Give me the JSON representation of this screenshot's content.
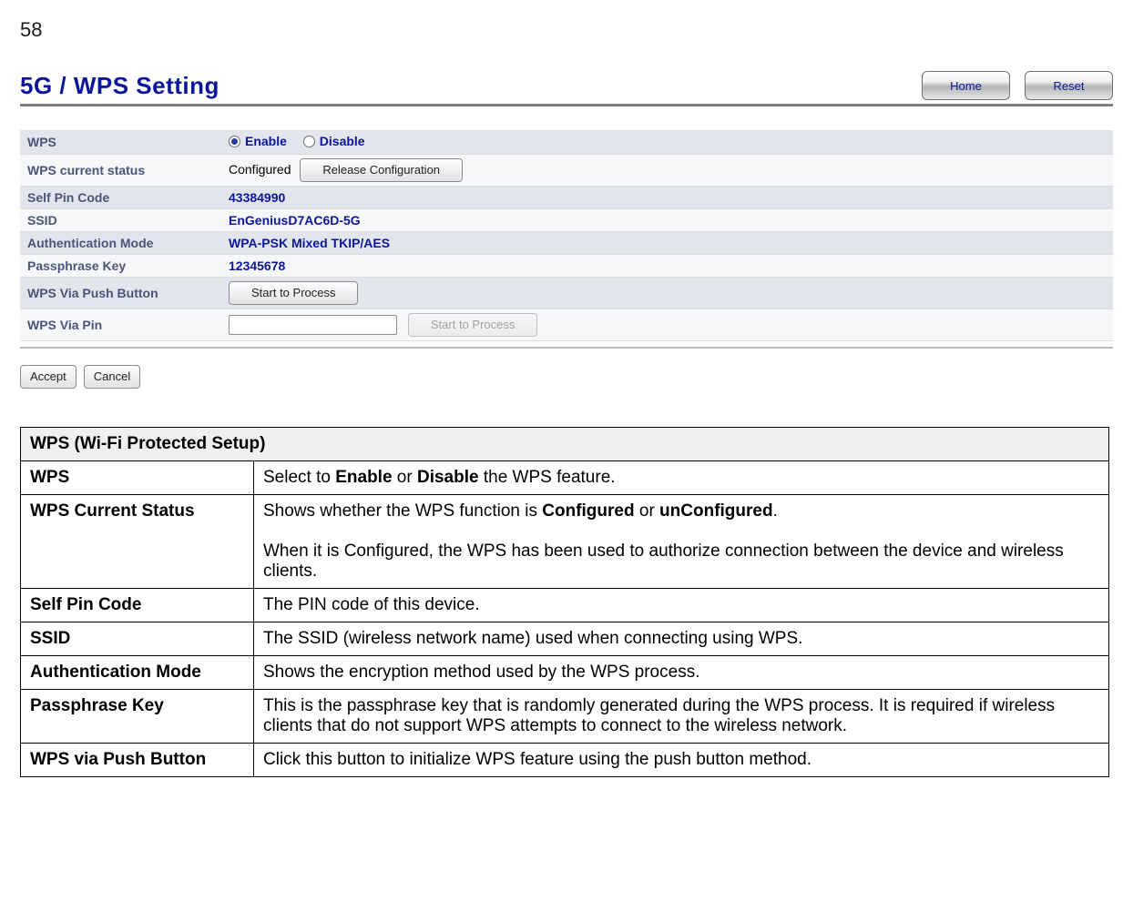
{
  "page_number": "58",
  "panel": {
    "title": "5G / WPS Setting",
    "home_btn": "Home",
    "reset_btn": "Reset",
    "rows": {
      "wps_label": "WPS",
      "wps_enable": "Enable",
      "wps_disable": "Disable",
      "status_label": "WPS current status",
      "status_value": "Configured",
      "release_btn": "Release Configuration",
      "pin_label": "Self Pin Code",
      "pin_value": "43384990",
      "ssid_label": "SSID",
      "ssid_value": "EnGeniusD7AC6D-5G",
      "auth_label": "Authentication Mode",
      "auth_value": "WPA-PSK Mixed TKIP/AES",
      "pass_label": "Passphrase Key",
      "pass_value": "12345678",
      "push_label": "WPS Via Push Button",
      "push_btn": "Start to Process",
      "pin_in_label": "WPS Via Pin",
      "pin_in_placeholder": "",
      "pin_in_btn": "Start to Process"
    },
    "accept_btn": "Accept",
    "cancel_btn": "Cancel"
  },
  "doc": {
    "section": "WPS (Wi-Fi Protected Setup)",
    "items": [
      {
        "term": "WPS",
        "html": "Select to <b>Enable</b> or <b>Disable</b> the WPS feature."
      },
      {
        "term": "WPS Current Status",
        "html": "Shows whether the WPS function is <b>Configured</b> or <b>unConfigured</b>.<br><br>When it is Configured, the WPS has been used to authorize connection between the device and wireless clients."
      },
      {
        "term": "Self Pin Code",
        "html": "The PIN code of this device."
      },
      {
        "term": "SSID",
        "html": "The SSID (wireless network name) used when connecting using WPS."
      },
      {
        "term": "Authentication Mode",
        "html": "Shows the encryption method used by the WPS process."
      },
      {
        "term": "Passphrase Key",
        "html": "This is the passphrase key that is randomly generated during the WPS process. It is required if wireless clients that do not support WPS attempts to connect to the wireless network."
      },
      {
        "term": "WPS via Push Button",
        "html": "Click this button to initialize WPS feature using the push button method."
      }
    ]
  }
}
